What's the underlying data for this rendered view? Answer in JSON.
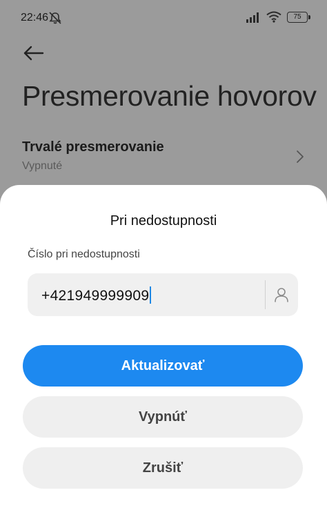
{
  "status_bar": {
    "time": "22:46",
    "battery": "75",
    "icons": [
      "muted-bell-icon",
      "signal-icon",
      "wifi-icon",
      "battery-icon"
    ]
  },
  "header": {
    "title": "Presmerovanie hovorov"
  },
  "setting": {
    "title": "Trvalé presmerovanie",
    "status": "Vypnuté"
  },
  "dialog": {
    "title": "Pri nedostupnosti",
    "field_label": "Číslo pri nedostupnosti",
    "phone_value": "+421949999909",
    "update_label": "Aktualizovať",
    "disable_label": "Vypnúť",
    "cancel_label": "Zrušiť"
  },
  "colors": {
    "accent": "#1d89f0",
    "scrim": "#9b9b9b",
    "sheet": "#ffffff"
  }
}
